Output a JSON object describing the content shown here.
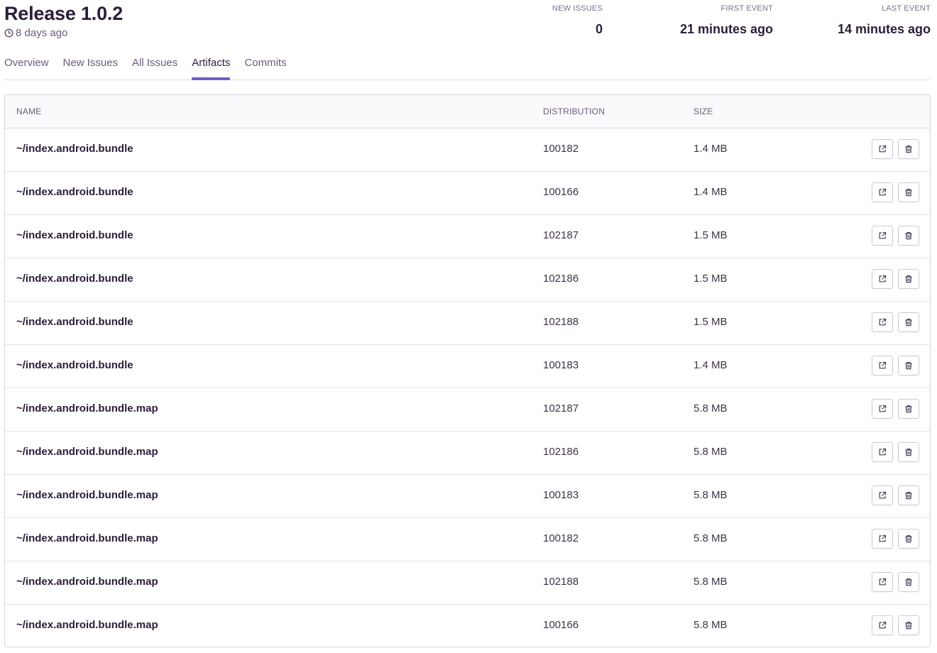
{
  "release": {
    "title": "Release 1.0.2",
    "age": "8 days ago"
  },
  "stats": [
    {
      "label": "NEW ISSUES",
      "value": "0"
    },
    {
      "label": "FIRST EVENT",
      "value": "21 minutes ago"
    },
    {
      "label": "LAST EVENT",
      "value": "14 minutes ago"
    }
  ],
  "tabs": [
    {
      "label": "Overview",
      "active": false
    },
    {
      "label": "New Issues",
      "active": false
    },
    {
      "label": "All Issues",
      "active": false
    },
    {
      "label": "Artifacts",
      "active": true
    },
    {
      "label": "Commits",
      "active": false
    }
  ],
  "table": {
    "columns": {
      "name": "NAME",
      "distribution": "DISTRIBUTION",
      "size": "SIZE"
    },
    "rows": [
      {
        "name": "~/index.android.bundle",
        "distribution": "100182",
        "size": "1.4 MB"
      },
      {
        "name": "~/index.android.bundle",
        "distribution": "100166",
        "size": "1.4 MB"
      },
      {
        "name": "~/index.android.bundle",
        "distribution": "102187",
        "size": "1.5 MB"
      },
      {
        "name": "~/index.android.bundle",
        "distribution": "102186",
        "size": "1.5 MB"
      },
      {
        "name": "~/index.android.bundle",
        "distribution": "102188",
        "size": "1.5 MB"
      },
      {
        "name": "~/index.android.bundle",
        "distribution": "100183",
        "size": "1.4 MB"
      },
      {
        "name": "~/index.android.bundle.map",
        "distribution": "102187",
        "size": "5.8 MB"
      },
      {
        "name": "~/index.android.bundle.map",
        "distribution": "102186",
        "size": "5.8 MB"
      },
      {
        "name": "~/index.android.bundle.map",
        "distribution": "100183",
        "size": "5.8 MB"
      },
      {
        "name": "~/index.android.bundle.map",
        "distribution": "100182",
        "size": "5.8 MB"
      },
      {
        "name": "~/index.android.bundle.map",
        "distribution": "102188",
        "size": "5.8 MB"
      },
      {
        "name": "~/index.android.bundle.map",
        "distribution": "100166",
        "size": "5.8 MB"
      }
    ]
  },
  "icons": {
    "clock": "clock-icon",
    "open": "external-link-icon",
    "delete": "trash-icon"
  },
  "colors": {
    "accent": "#6c5fc7",
    "text": "#2b1d38",
    "muted": "#6b5b7a"
  }
}
